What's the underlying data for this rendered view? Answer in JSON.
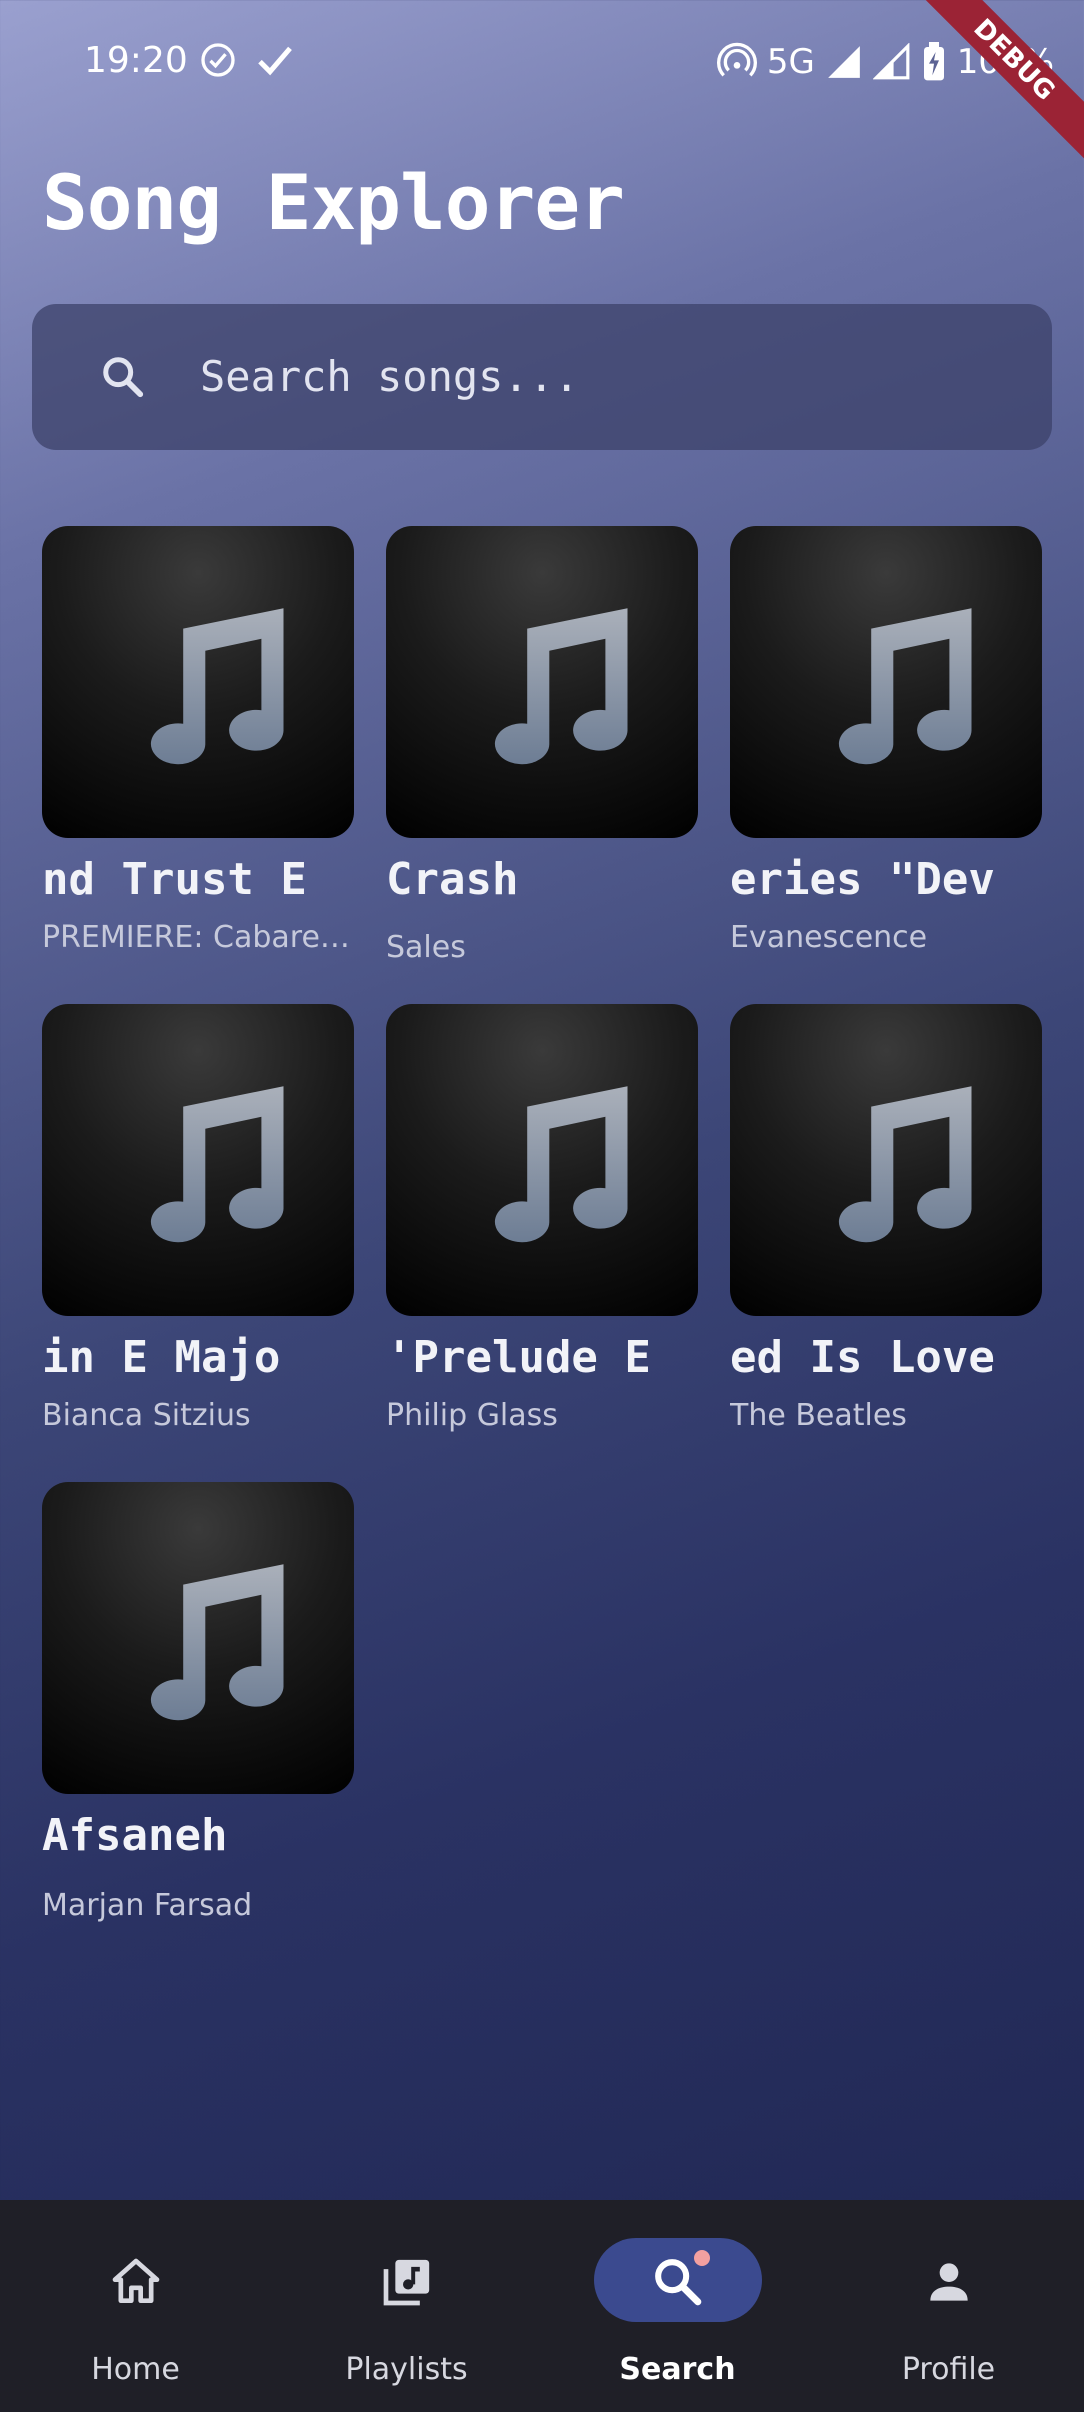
{
  "status_bar": {
    "time": "19:20",
    "network": "5G",
    "battery": "100%",
    "debug_label": "DEBUG"
  },
  "header": {
    "title": "Song Explorer"
  },
  "search": {
    "placeholder": "Search songs..."
  },
  "songs": [
    {
      "title": "nd Trust  E",
      "artist": "PREMIERE: Cabaret..."
    },
    {
      "title": "Crash",
      "artist": "Sales"
    },
    {
      "title": "eries \"Dev",
      "artist": "Evanescence"
    },
    {
      "title": "in E Majo",
      "artist": "Bianca Sitzius"
    },
    {
      "title": "'Prelude  E",
      "artist": "Philip Glass"
    },
    {
      "title": "ed Is Love",
      "artist": "The Beatles"
    },
    {
      "title": "Afsaneh",
      "artist": "Marjan Farsad"
    }
  ],
  "nav": {
    "items": [
      {
        "label": "Home",
        "icon": "home-icon"
      },
      {
        "label": "Playlists",
        "icon": "playlist-icon"
      },
      {
        "label": "Search",
        "icon": "search-icon",
        "active": true
      },
      {
        "label": "Profile",
        "icon": "person-icon"
      }
    ]
  },
  "colors": {
    "accent": "#3b4a8f",
    "debug": "#9b2335",
    "badge": "#f3a0a0"
  }
}
